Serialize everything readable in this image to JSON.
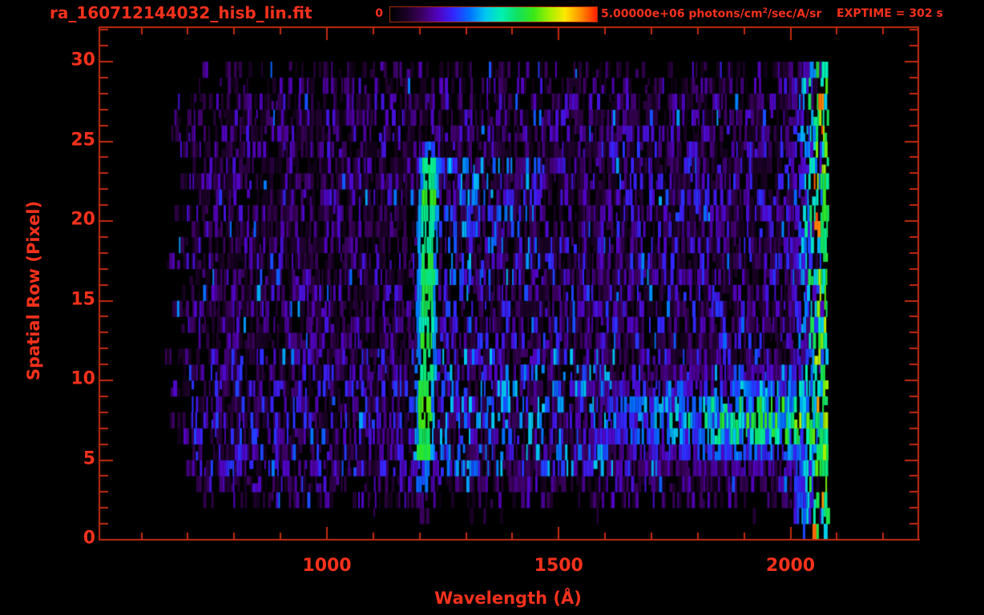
{
  "header": {
    "title": "ra_160712144032_hisb_lin.fit",
    "exptime": "EXPTIME = 302 s"
  },
  "colorbar": {
    "min_label": "0",
    "max_value": "5.00000e+06",
    "units_prefix": " photons/cm",
    "units_sup": "2",
    "units_suffix": "/sec/A/sr"
  },
  "colors": {
    "background": "#000000",
    "accent_text": "#f4311c",
    "frame": "#c22b10",
    "colormap": [
      "#000000",
      "#1a0025",
      "#3c0060",
      "#5202c0",
      "#3228ff",
      "#0071ff",
      "#00c8f0",
      "#00f0b0",
      "#10e060",
      "#38e818",
      "#a0f000",
      "#ffe800",
      "#ff8c00",
      "#ff1e00"
    ]
  },
  "chart_data": {
    "type": "heatmap",
    "title": "ra_160712144032_hisb_lin.fit",
    "xlabel": "Wavelength (Å)",
    "ylabel": "Spatial Row (Pixel)",
    "x_axis_range": [
      505,
      2278
    ],
    "y_axis_range": [
      0,
      32.2
    ],
    "x_ticks_major": [
      {
        "value": 1000,
        "label": "1000"
      },
      {
        "value": 1500,
        "label": "1500"
      },
      {
        "value": 2000,
        "label": "2000"
      }
    ],
    "x_minor_tick_values": [
      600,
      700,
      800,
      900,
      1000,
      1100,
      1200,
      1300,
      1400,
      1500,
      1600,
      1700,
      1800,
      1900,
      2000,
      2100,
      2200
    ],
    "y_ticks_major": [
      {
        "value": 0,
        "label": "0"
      },
      {
        "value": 5,
        "label": "5"
      },
      {
        "value": 10,
        "label": "10"
      },
      {
        "value": 15,
        "label": "15"
      },
      {
        "value": 20,
        "label": "20"
      },
      {
        "value": 25,
        "label": "25"
      },
      {
        "value": 30,
        "label": "30"
      }
    ],
    "y_minor_tick_step": 1,
    "y_minor_tick_max": 32,
    "intensity_range": [
      0,
      5000000
    ],
    "intensity_units": "photons/cm2/sec/A/sr",
    "exposure_time_s": 302,
    "data_extent": {
      "wavelength": [
        665,
        2078
      ],
      "rows": [
        0,
        30
      ]
    },
    "features": {
      "emission_line": {
        "wavelength_center": 1216,
        "tilt_A_per_row": 0.6,
        "core_half_width_A": 14,
        "fringe_half_width_A": 22,
        "row_range": [
          4.6,
          24.3
        ],
        "intensity_frac_range": [
          0.48,
          0.72
        ]
      },
      "continuum_band": {
        "wavelength_range": [
          1540,
          2078
        ],
        "row_center": 7.6,
        "row_sigma": 2.1,
        "peak_intensity_frac": 0.72
      },
      "right_edge_band": {
        "wavelength_start": 1995,
        "red_spike_wavelength": 2050,
        "red_spike_prob": 0.07,
        "intensity_frac_range": [
          0.15,
          1.0
        ]
      },
      "background_noise": {
        "fill_fraction": 0.88,
        "intensity_frac_range": [
          0.05,
          0.27
        ]
      },
      "enhanced_regions": [
        {
          "rows": [
            4.5,
            11.5
          ],
          "wavelength": [
            1240,
            1620
          ],
          "boost": 1.8
        },
        {
          "rows": [
            16.5,
            24.3
          ],
          "wavelength": [
            1240,
            1460
          ],
          "boost": 1.7
        },
        {
          "rows": [
            11.5,
            16.5
          ],
          "wavelength": [
            1240,
            1600
          ],
          "boost": 1.3
        },
        {
          "rows": [
            5,
            25
          ],
          "wavelength": [
            1460,
            2000
          ],
          "boost": 1.2
        },
        {
          "rows": [
            4.5,
            11.5
          ],
          "wavelength": [
            700,
            1200
          ],
          "boost": 1.25
        }
      ]
    }
  }
}
